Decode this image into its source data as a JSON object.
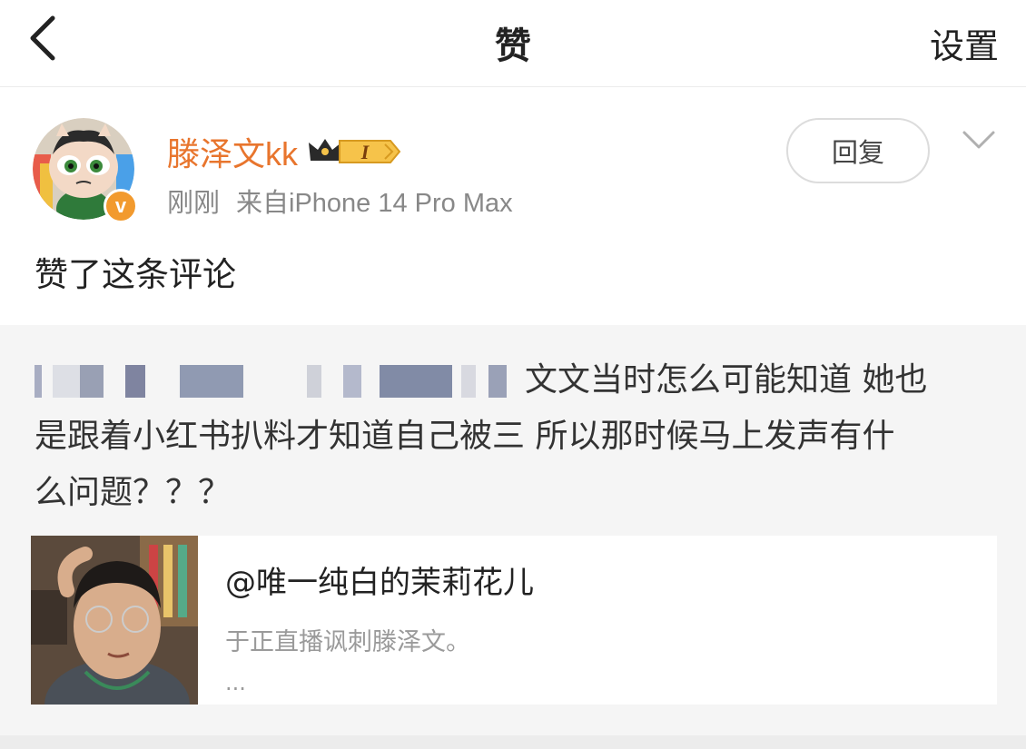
{
  "nav": {
    "title": "赞",
    "settings_label": "设置",
    "back_icon": "chevron-left-icon"
  },
  "post": {
    "username": "滕泽文kk",
    "level_badge": "I",
    "time": "刚刚",
    "source": "来自iPhone 14 Pro Max",
    "reply_label": "回复",
    "action_text": "赞了这条评论",
    "verified_badge": "v"
  },
  "comment": {
    "text_line1": "文文当时怎么可能知道 她也",
    "text_line2": "是跟着小红书扒料才知道自己被三 所以那时候马上发声有什",
    "text_line3": "么问题？？？"
  },
  "card": {
    "title": "@唯一纯白的茉莉花儿",
    "subtitle": "于正直播讽刺滕泽文。",
    "more": "..."
  },
  "colors": {
    "accent_orange": "#e8752d",
    "verified_orange": "#f29a2e",
    "comment_bg": "#f5f5f5"
  }
}
